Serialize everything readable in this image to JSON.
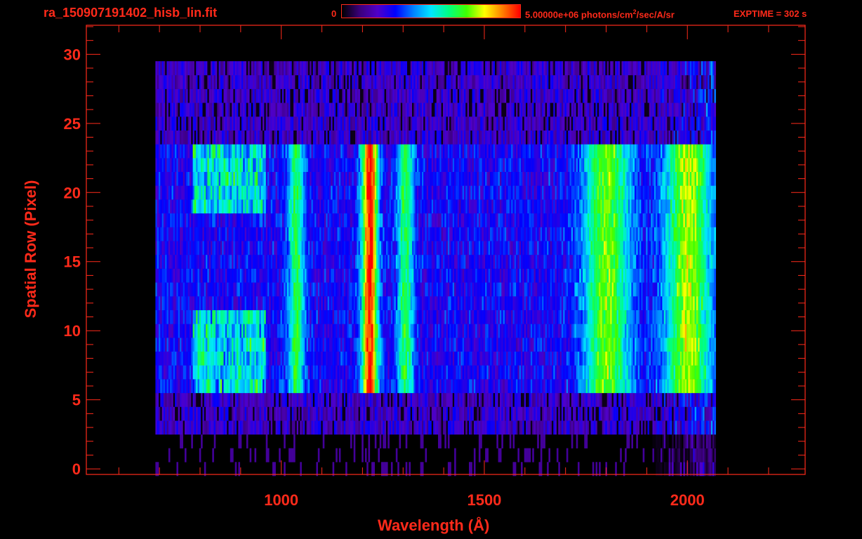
{
  "header": {
    "file_title": "ra_150907191402_hisb_lin.fit",
    "colorbar_min": "0",
    "colorbar_max_value": "5.00000e+06",
    "colorbar_units_prefix": " photons/cm",
    "colorbar_units_sup": "2",
    "colorbar_units_suffix": "/sec/A/sr",
    "exptime": "EXPTIME = 302 s"
  },
  "colors": {
    "accent": "#ff2a1a",
    "background": "#000000",
    "colormap": [
      "#000000",
      "#3a007a",
      "#5000c8",
      "#0000ff",
      "#0080ff",
      "#00e6ff",
      "#00ff80",
      "#40ff00",
      "#ffff00",
      "#ff8000",
      "#ff0000"
    ]
  },
  "chart_data": {
    "type": "heatmap",
    "title": "ra_150907191402_hisb_lin.fit",
    "xlabel": "Wavelength (Å)",
    "ylabel": "Spatial Row (Pixel)",
    "xlim": [
      520,
      2290
    ],
    "ylim": [
      -0.4,
      32.1
    ],
    "x_ticks": [
      1000,
      1500,
      2000
    ],
    "x_tick_labels": [
      "1000",
      "1500",
      "2000"
    ],
    "x_minor_step": 100,
    "y_ticks": [
      0,
      5,
      10,
      15,
      20,
      25,
      30
    ],
    "y_tick_labels": [
      "0",
      "5",
      "10",
      "15",
      "20",
      "25",
      "30"
    ],
    "y_minor_step": 1,
    "colorbar_range": [
      0,
      5000000
    ],
    "colorbar_units": "photons/cm^2/sec/A/sr",
    "data_extent": {
      "wavelength_start": 690,
      "wavelength_end": 2070,
      "row_start": 0,
      "row_end": 30
    },
    "spatial_rows_illuminated": [
      6,
      24
    ],
    "features": [
      {
        "wavelength": 1216,
        "relative_intensity": 0.9
      },
      {
        "wavelength": 1304,
        "relative_intensity": 0.45
      },
      {
        "wavelength": 1035,
        "relative_intensity": 0.45
      },
      {
        "wavelength": 1800,
        "relative_intensity": 0.55
      },
      {
        "wavelength": 2000,
        "relative_intensity": 0.6
      }
    ]
  }
}
